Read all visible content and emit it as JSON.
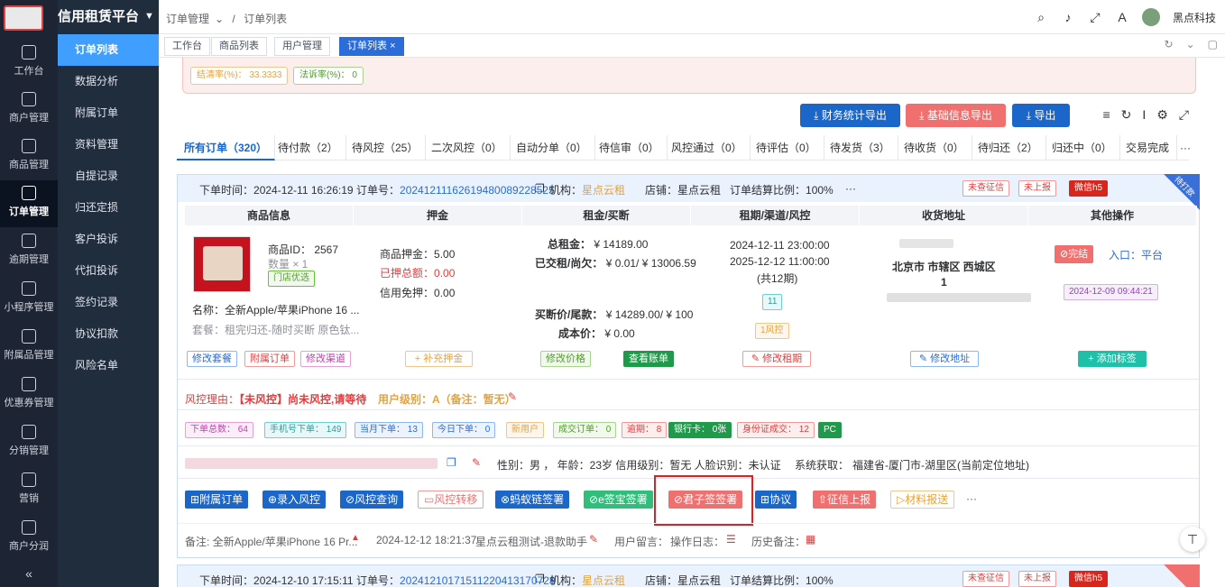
{
  "app": {
    "title": "信用租赁平台"
  },
  "rail": [
    {
      "label": "工作台",
      "icon": "home-icon"
    },
    {
      "label": "商户管理",
      "icon": "shop-icon"
    },
    {
      "label": "商品管理",
      "icon": "apple-icon"
    },
    {
      "label": "订单管理",
      "icon": "trophy-icon"
    },
    {
      "label": "逾期管理",
      "icon": "alarm-icon"
    },
    {
      "label": "小程序管理",
      "icon": "watch-icon"
    },
    {
      "label": "附属品管理",
      "icon": "cart-icon"
    },
    {
      "label": "优惠券管理",
      "icon": "gift-icon"
    },
    {
      "label": "分销管理",
      "icon": "chart-icon"
    },
    {
      "label": "营销",
      "icon": "megaphone-icon"
    },
    {
      "label": "商户分润",
      "icon": "yen-icon"
    }
  ],
  "submenu": [
    "订单列表",
    "数据分析",
    "附属订单",
    "资料管理",
    "自提记录",
    "归还定损",
    "客户投诉",
    "代扣投诉",
    "签约记录",
    "协议扣款",
    "风险名单"
  ],
  "header": {
    "breadcrumb": [
      "订单管理",
      "/",
      "订单列表"
    ],
    "user": "黑点科技"
  },
  "tabs": [
    {
      "label": "工作台"
    },
    {
      "label": "商品列表"
    },
    {
      "label": "用户管理"
    },
    {
      "label": "订单列表",
      "close": "×"
    }
  ],
  "stats": {
    "clearance": "结清率(%)： 33.3333",
    "legal": "法诉率(%)： 0"
  },
  "actions": {
    "finance_export": "财务统计导出",
    "basic_export": "基础信息导出",
    "export": "导出"
  },
  "status_tabs": [
    "所有订单（320）",
    "待付款（2）",
    "待风控（25）",
    "二次风控（0）",
    "自动分单（0）",
    "待信审（0）",
    "风控通过（0）",
    "待评估（0）",
    "待发货（3）",
    "待收货（0）",
    "待归还（2）",
    "归还中（0）",
    "交易完成"
  ],
  "order1": {
    "time_label": "下单时间：",
    "time": "2024-12-11 16:26:19",
    "no_label": "订单号：",
    "no": "20241211162619480089228525",
    "org_label": "机构：",
    "org": "星点云租",
    "store_label": "店铺：",
    "store": "星点云租",
    "ratio_label": "订单结算比例：",
    "ratio": "100%",
    "more": "···",
    "badge_credit": "未查征信",
    "badge_report": "未上报",
    "badge_wx": "微信h5",
    "ribbon": "待打款",
    "cols": [
      "商品信息",
      "押金",
      "租金/买断",
      "租期/渠道/风控",
      "收货地址",
      "其他操作"
    ],
    "product_id": "商品ID： 2567",
    "qty": "数量 × 1",
    "store_tag": "门店优选",
    "name": "名称：全新Apple/苹果iPhone 16 ...",
    "package": "套餐：租完归还-随时买断 原色钛...",
    "btn_edit_pkg": "修改套餐",
    "btn_sub_order": "附属订单",
    "btn_edit_channel": "修改渠道",
    "deposit_label": "商品押金：",
    "deposit": "5.00",
    "paid_deposit_label": "已押总额：",
    "paid_deposit": "0.00",
    "credit_free_label": "信用免押：",
    "credit_free": "0.00",
    "btn_add_deposit": "+ 补充押金",
    "total_rent_label": "总租金：",
    "total_rent": "¥ 14189.00",
    "paid_owe_label": "已交租/尚欠：",
    "paid_owe": "¥ 0.01/ ¥ 13006.59",
    "buyout_label": "买断价/尾款：",
    "buyout": "¥ 14289.00/ ¥ 100",
    "cost_label": "成本价：",
    "cost": "¥ 0.00",
    "btn_edit_price": "修改价格",
    "btn_bill": "查看账单",
    "start": "2024-12-11 23:00:00",
    "end": "2025-12-12 11:00:00",
    "periods": "(共12期)",
    "channel_tag": "11",
    "risk_tag": "1风控",
    "btn_edit_term": "修改租期",
    "address": "北京市 市辖区 西城区",
    "address2": "1",
    "btn_edit_addr": "修改地址",
    "btn_finish": "完结",
    "entry": "入口：",
    "entry_val": "平台",
    "date_tag": "2024-12-09 09:44:21",
    "btn_add_tag": "+ 添加标签",
    "risk_reason_label": "风控理由：",
    "risk_reason": "【未风控】尚未风控,请等待",
    "user_level": "用户级别：A（备注：暂无）",
    "chips": [
      "下单总数： 64",
      "手机号下单： 149",
      "当月下单： 13",
      "今日下单： 0",
      "新用户",
      "成交订单： 0",
      "逾期： 8",
      "银行卡： 0张",
      "身份证成交： 12",
      "PC"
    ],
    "info": "性别：男 ， 年龄：23岁  信用级别：暂无  人脸识别：未认证",
    "sys_get": "系统获取：",
    "location": "福建省-厦门市-湖里区(当前定位地址)",
    "act_buttons": [
      "附属订单",
      "录入风控",
      "风控查询",
      "风控转移",
      "蚂蚁链签署",
      "e签宝签署",
      "君子签签署",
      "协议",
      "征信上报",
      "材料报送"
    ],
    "note": "备注: 全新Apple/苹果iPhone 16 Pr...",
    "note_time": "2024-12-12 18:21:37",
    "note_by": "星点云租测试-退款助手",
    "user_msg": "用户留言：",
    "op_log": "操作日志：",
    "history": "历史备注："
  },
  "order2": {
    "time_label": "下单时间：",
    "time": "2024-12-10 17:15:11",
    "no_label": "订单号：",
    "no": "20241210171511220413170729",
    "org_label": "机构：",
    "org": "星点云租",
    "store_label": "店铺：",
    "store": "星点云租",
    "ratio_label": "订单结算比例：",
    "ratio": "100%",
    "badge_credit": "未查征信",
    "badge_report": "未上报",
    "badge_wx": "微信h5"
  }
}
